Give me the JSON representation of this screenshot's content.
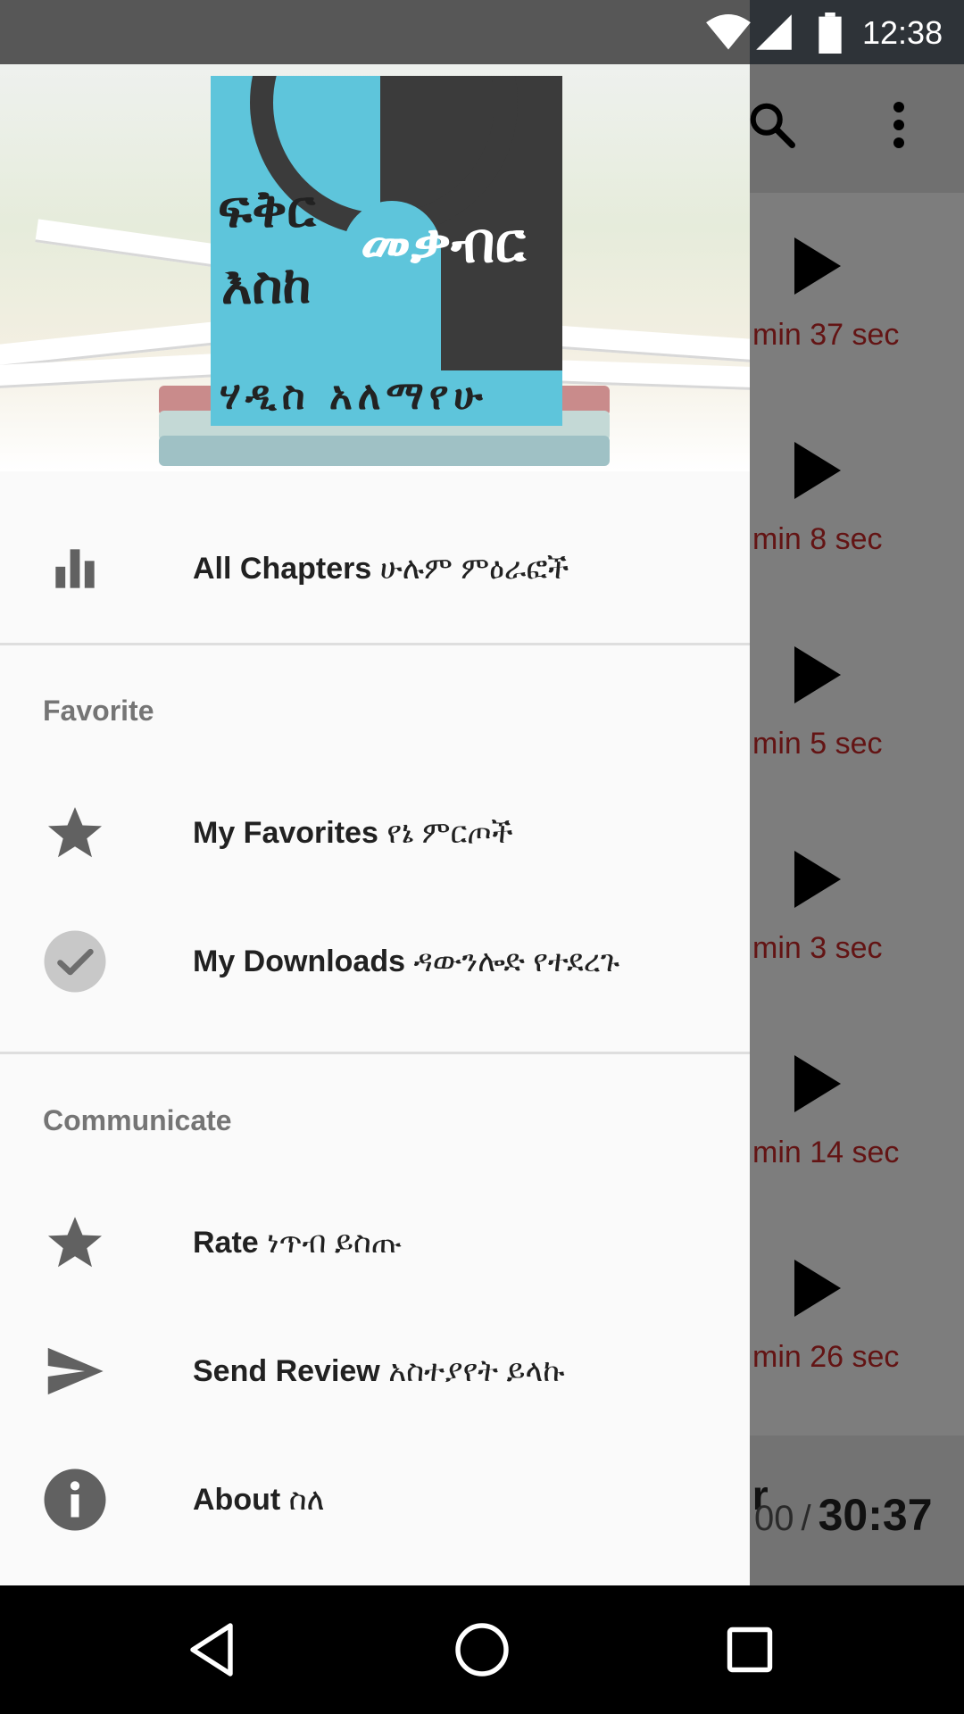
{
  "status_bar": {
    "clock": "12:38",
    "icons": [
      "wifi-icon",
      "cell-signal-icon",
      "battery-icon"
    ]
  },
  "background_app": {
    "toolbar_icons": [
      "search-icon",
      "more-vert-icon"
    ],
    "rows": [
      {
        "duration": "min 37 sec"
      },
      {
        "duration": "min 8 sec"
      },
      {
        "duration": "min 5 sec"
      },
      {
        "duration": "min 3 sec"
      },
      {
        "duration": "min 14 sec"
      },
      {
        "duration": "min 26 sec"
      }
    ],
    "player": {
      "title_fragment": "ir",
      "current_fragment": "00",
      "separator": "/",
      "total": "30:37"
    }
  },
  "drawer": {
    "cover": {
      "line1": "ፍቅር",
      "line2": "እስከ",
      "line3": "መቃብር",
      "author": "ሃዲስ አለማየሁ"
    },
    "main_item": {
      "label_en": "All Chapters",
      "label_am": "ሁሉም ምዕራፎች",
      "icon": "bar-chart-icon"
    },
    "sections": [
      {
        "title": "Favorite",
        "items": [
          {
            "label_en": "My Favorites",
            "label_am": "የኔ ምርጦች",
            "icon": "star-icon"
          },
          {
            "label_en": "My Downloads",
            "label_am": "ዳውንሎድ የተደረጉ",
            "icon": "check-circle-icon"
          }
        ]
      },
      {
        "title": "Communicate",
        "items": [
          {
            "label_en": "Rate",
            "label_am": "ነጥብ ይስጡ",
            "icon": "star-icon"
          },
          {
            "label_en": "Send Review",
            "label_am": "አስተያየት ይላኩ",
            "icon": "send-icon"
          },
          {
            "label_en": "About",
            "label_am": "ስለ",
            "icon": "info-icon"
          }
        ]
      }
    ]
  },
  "nav_bar": {
    "buttons": [
      "back",
      "home",
      "recents"
    ]
  },
  "colors": {
    "duration_text": "#c62828",
    "drawer_bg": "#fafafa",
    "icon_gray": "#616161",
    "cover_blue": "#5ec5db",
    "cover_dark": "#3b3b3b"
  }
}
